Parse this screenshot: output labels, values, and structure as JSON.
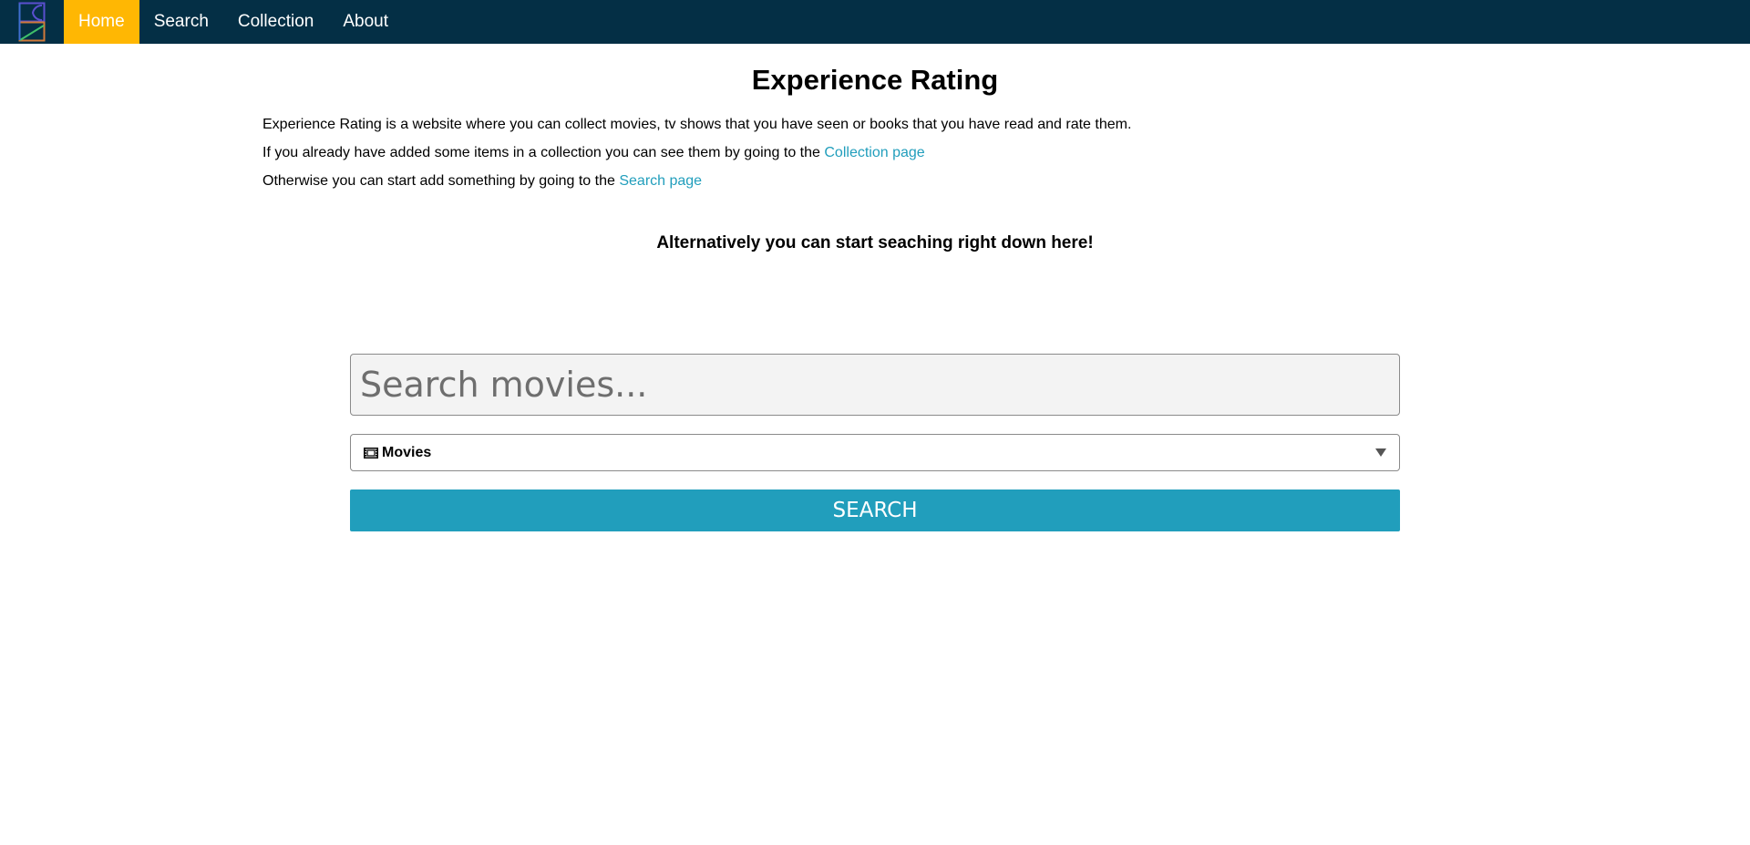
{
  "nav": {
    "items": [
      {
        "label": "Home"
      },
      {
        "label": "Search"
      },
      {
        "label": "Collection"
      },
      {
        "label": "About"
      }
    ]
  },
  "main": {
    "title": "Experience Rating",
    "intro": "Experience Rating is a website where you can collect movies, tv shows that you have seen or books that you have read and rate them.",
    "collection_text": "If you already have added some items in a collection you can see them by going to the",
    "collection_link": "Collection page",
    "search_text": "Otherwise you can start add something by going to the",
    "search_link": "Search page",
    "subheading": "Alternatively you can start seaching right down here!"
  },
  "search": {
    "placeholder": "Search movies...",
    "value": "",
    "category": "Movies",
    "category_icon": "film-icon",
    "button_label": "SEARCH"
  },
  "colors": {
    "navbar": "#042f45",
    "active_tab": "#ffb703",
    "accent": "#219ebc"
  }
}
